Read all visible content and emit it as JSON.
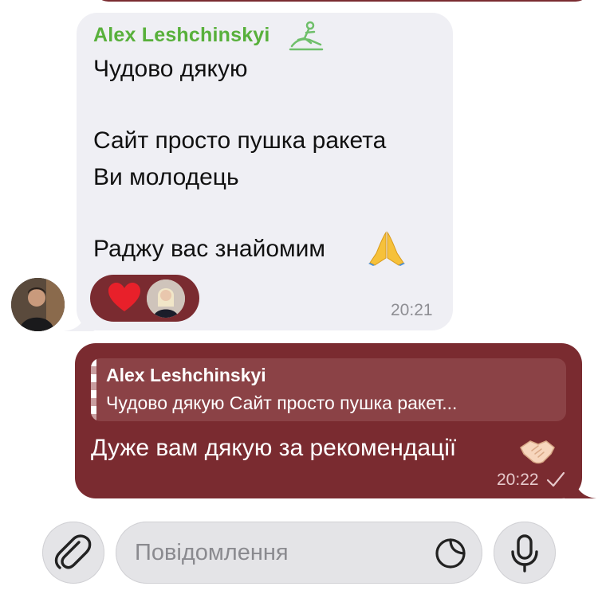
{
  "incoming": {
    "sender": "Alex Leshchinskyi",
    "lines": [
      "Чудово дякую",
      "Сайт просто пушка ракета",
      "Ви молодець",
      "Раджу вас знайомим"
    ],
    "emoji": "pray-emoji",
    "reaction": "heart-emoji",
    "time": "20:21"
  },
  "outgoing": {
    "reply_name": "Alex Leshchinskyi",
    "reply_text": "Чудово дякую Сайт просто пушка ракет...",
    "text": "Дуже вам дякую за рекомендації",
    "emoji": "handshake-emoji",
    "time": "20:22",
    "status_icon": "check-icon"
  },
  "composer": {
    "placeholder": "Повідомлення",
    "icons": [
      "paperclip-icon",
      "sticker-icon",
      "microphone-icon"
    ]
  },
  "colors": {
    "sender_name": "#58b03b",
    "outgoing_bubble": "#7a2b30",
    "incoming_bubble": "#efeff4"
  }
}
